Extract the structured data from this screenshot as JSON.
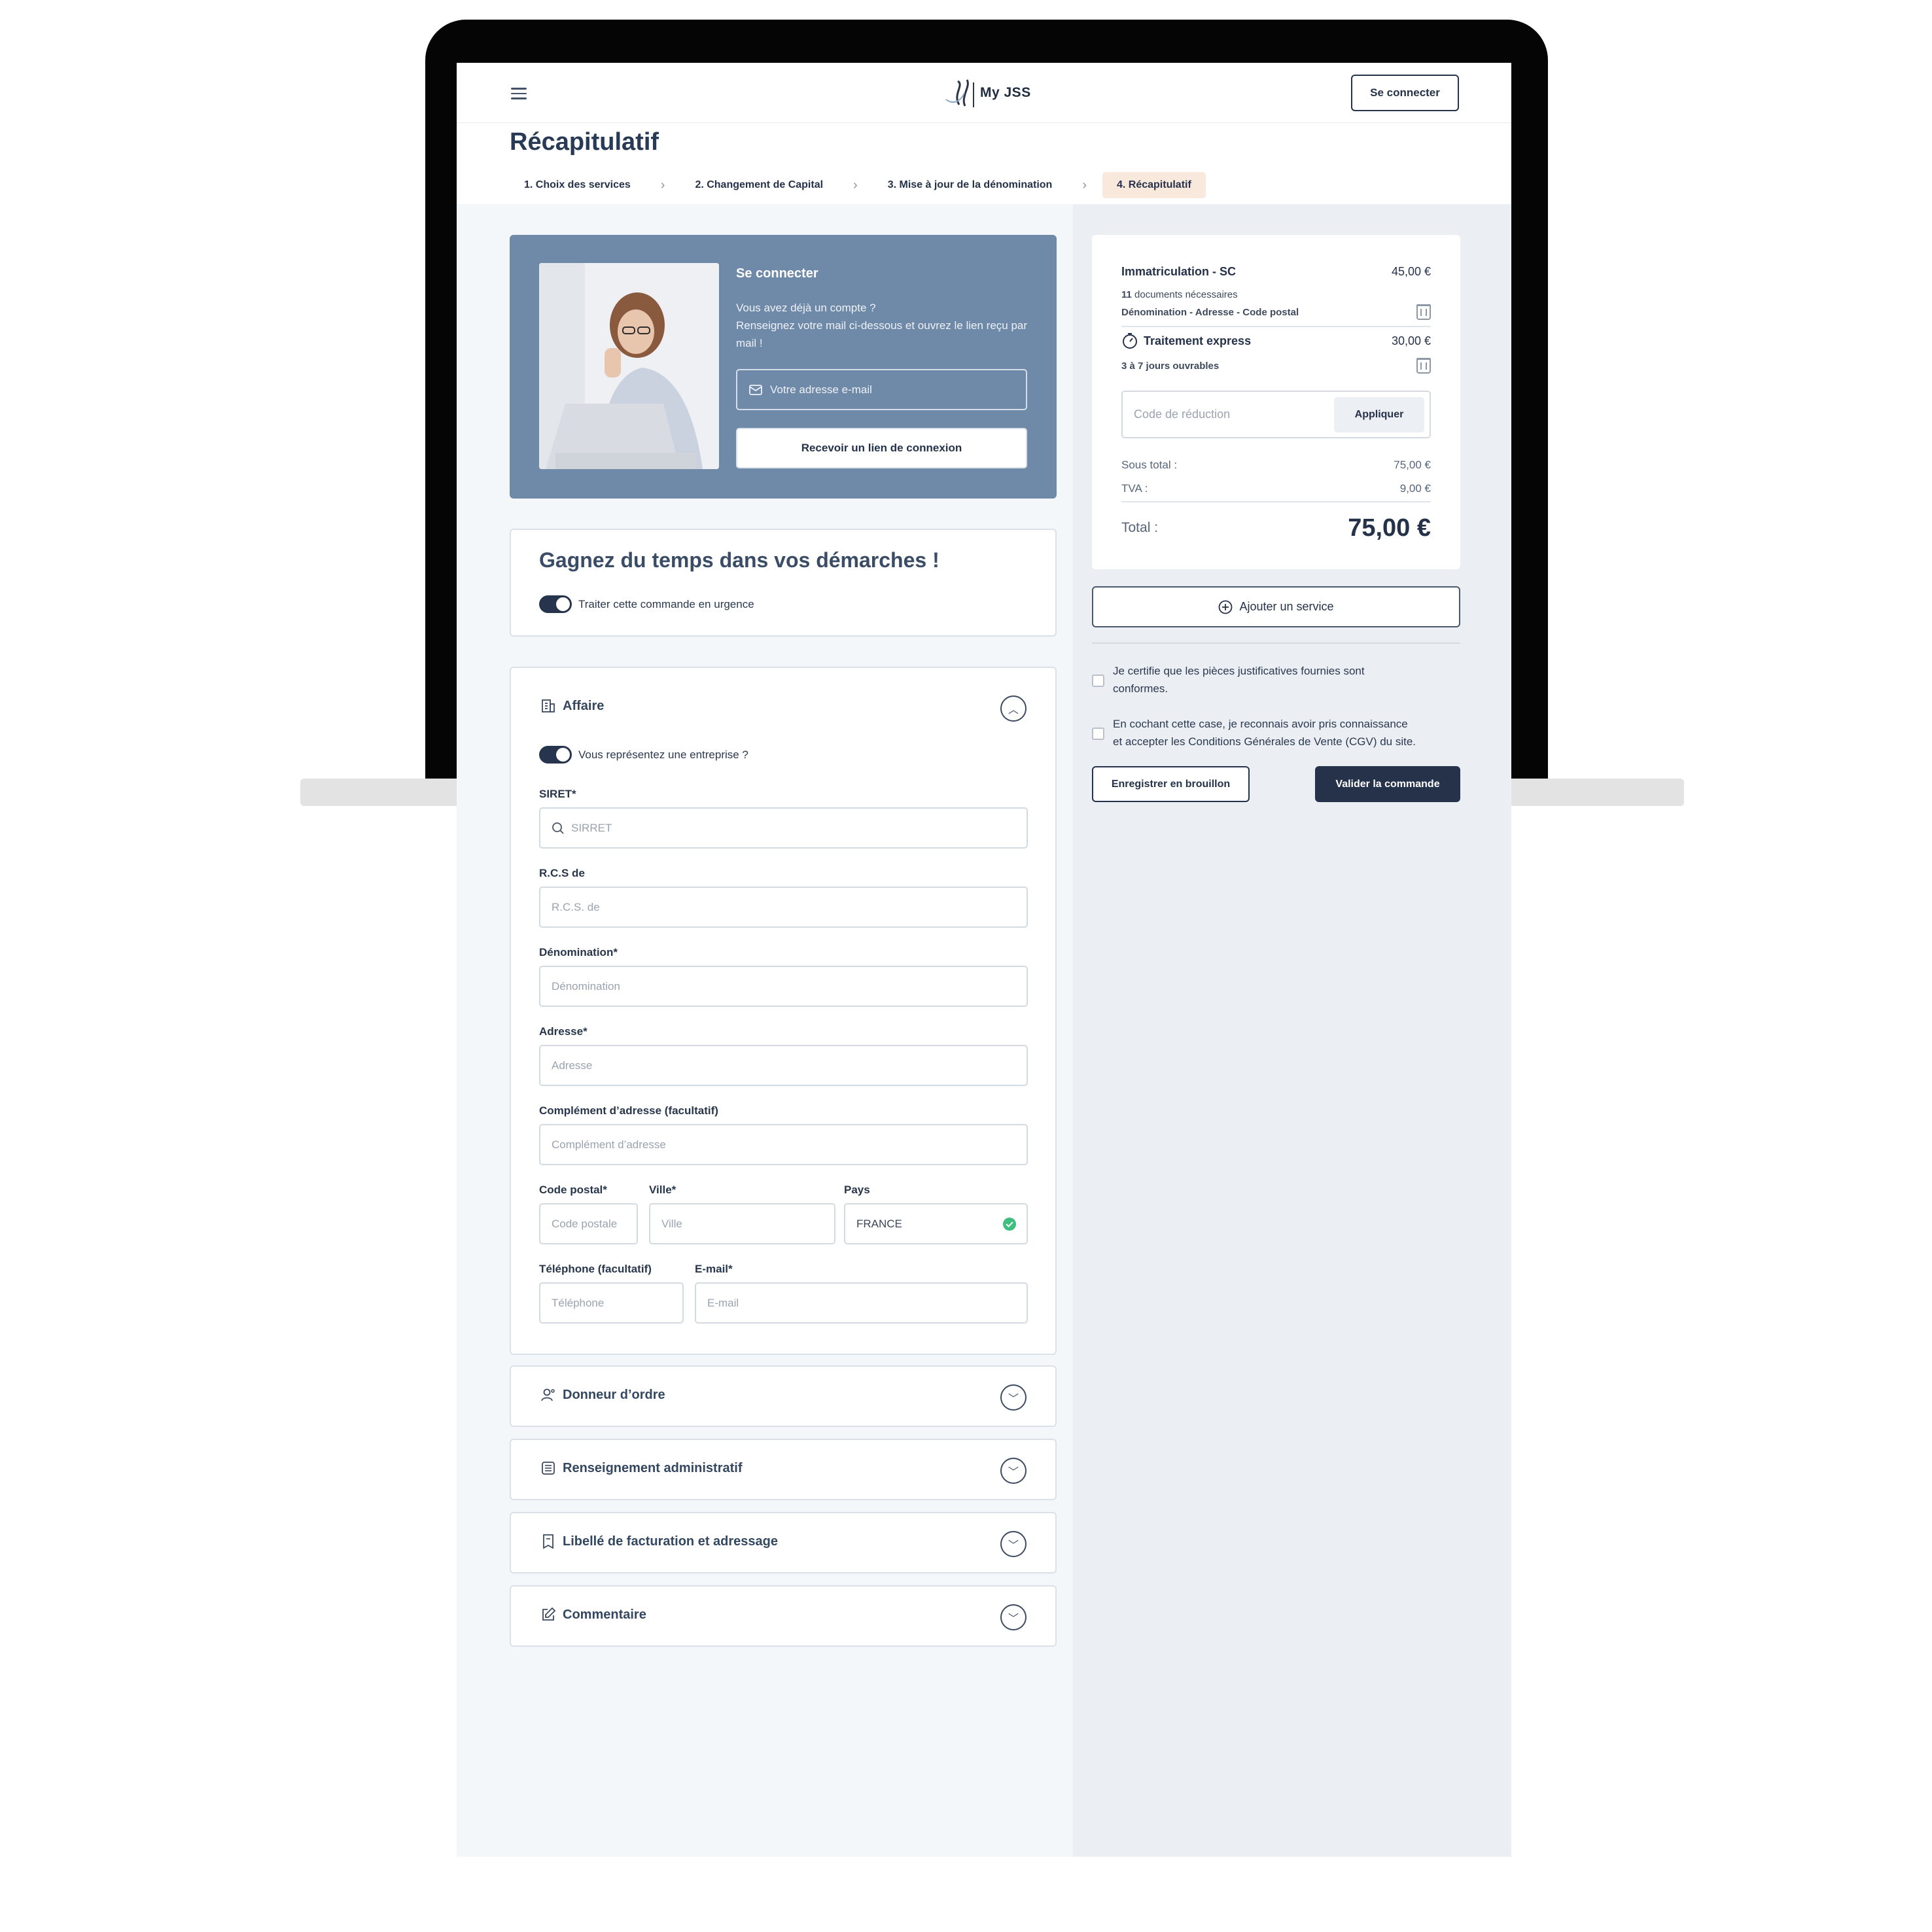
{
  "app": {
    "logo_text": "My JSS"
  },
  "header": {
    "login_label": "Se connecter"
  },
  "page": {
    "title": "Récapitulatif"
  },
  "steps": [
    {
      "label": "1. Choix des services"
    },
    {
      "label": "2. Changement de Capital"
    },
    {
      "label": "3. Mise à jour de la dénomination"
    },
    {
      "label": "4. Récapitulatif"
    }
  ],
  "login_card": {
    "title": "Se connecter",
    "desc_line1": "Vous avez déjà un compte ?",
    "desc_line2": "Renseignez votre mail ci-dessous et ouvrez le lien reçu par mail !",
    "email_placeholder": "Votre adresse e-mail",
    "button_label": "Recevoir un lien de connexion"
  },
  "urgency": {
    "title": "Gagnez du temps dans vos démarches !",
    "toggle_label": "Traiter cette commande en urgence"
  },
  "affaire": {
    "title": "Affaire",
    "toggle_label": "Vous représentez une entreprise ?",
    "siret_label": "SIRET*",
    "siret_placeholder": "SIRRET",
    "rcs_label": "R.C.S de",
    "rcs_placeholder": "R.C.S. de",
    "denomination_label": "Dénomination*",
    "denomination_placeholder": "Dénomination",
    "address_label": "Adresse*",
    "address_placeholder": "Adresse",
    "complement_label": "Complément d’adresse (facultatif)",
    "complement_placeholder": "Complément d’adresse",
    "postal_label": "Code postal*",
    "postal_placeholder": "Code postale",
    "city_label": "Ville*",
    "city_placeholder": "Ville",
    "country_label": "Pays",
    "country_value": "FRANCE",
    "phone_label": "Téléphone (facultatif)",
    "phone_placeholder": "Téléphone",
    "email_label": "E-mail*",
    "email_placeholder": "E-mail"
  },
  "accordions": [
    {
      "title": "Donneur d’ordre"
    },
    {
      "title": "Renseignement administratif"
    },
    {
      "title": "Libellé de facturation et adressage"
    },
    {
      "title": "Commentaire"
    }
  ],
  "summary": {
    "item1_name": "Immatriculation - SC",
    "item1_price": "45,00 €",
    "item1_docs_count": "11",
    "item1_docs_text": "documents nécessaires",
    "item1_detail": "Dénomination - Adresse - Code postal",
    "item2_name": "Traitement express",
    "item2_price": "30,00 €",
    "item2_detail": "3 à 7 jours ouvrables",
    "discount_placeholder": "Code de réduction",
    "discount_button": "Appliquer",
    "subtotal_label": "Sous total :",
    "subtotal_value": "75,00 €",
    "tva_label": "TVA :",
    "tva_value": "9,00 €",
    "total_label": "Total :",
    "total_value": "75,00 €"
  },
  "actions": {
    "add_service": "Ajouter un service",
    "certify_text_1": "Je certifie que les pièces justificatives fournies sont",
    "certify_text_2": "conformes.",
    "cgv_text_1": "En cochant cette case, je reconnais avoir pris connaissance",
    "cgv_text_2": "et accepter les Conditions Générales de Vente (CGV) du site.",
    "draft_button": "Enregistrer en brouillon",
    "validate_button": "Valider la commande"
  },
  "colors": {
    "accent_dark": "#25324a",
    "card_blue": "#6f89a8",
    "step_active": "#f9e8dc",
    "success": "#3fbf7f"
  }
}
